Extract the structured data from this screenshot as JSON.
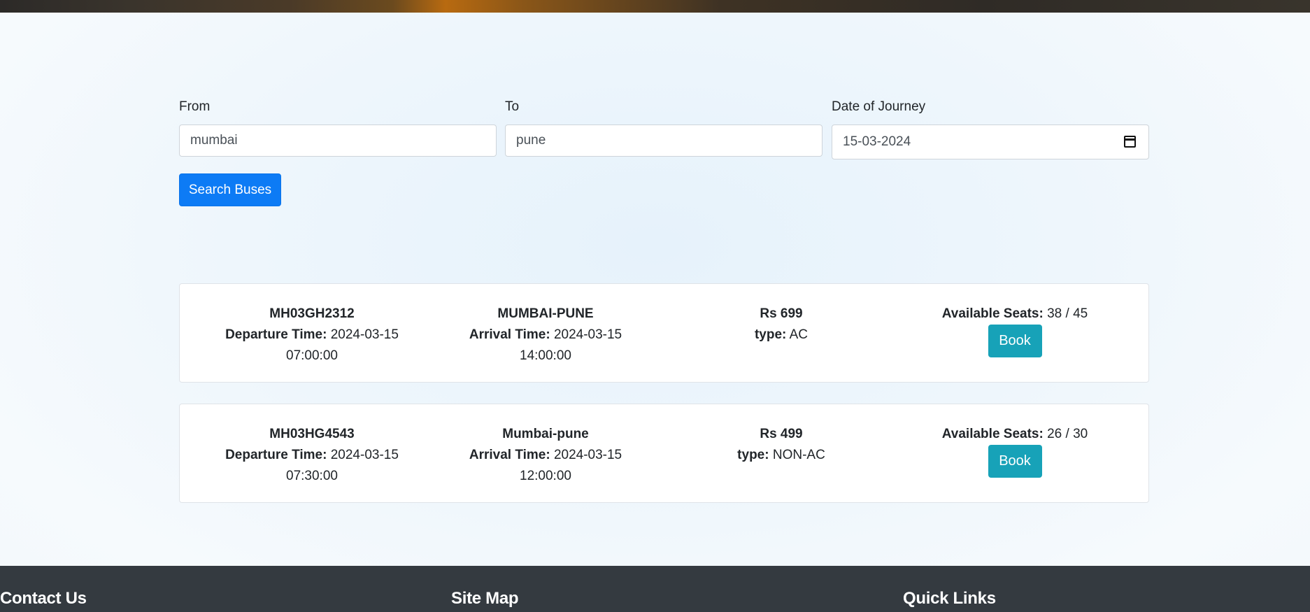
{
  "search": {
    "from_label": "From",
    "from_value": "mumbai",
    "to_label": "To",
    "to_value": "pune",
    "date_label": "Date of Journey",
    "date_value": "15-03-2024",
    "button_label": "Search Buses"
  },
  "labels": {
    "departure": "Departure Time:",
    "arrival": "Arrival Time:",
    "type": "type:",
    "seats": "Available Seats:",
    "book": "Book"
  },
  "buses": [
    {
      "bus_number": "MH03GH2312",
      "departure_date": "2024-03-15",
      "departure_time": "07:00:00",
      "route": "MUMBAI-PUNE",
      "arrival_date": "2024-03-15",
      "arrival_time": "14:00:00",
      "price": "Rs 699",
      "type": "AC",
      "seats": "38 / 45"
    },
    {
      "bus_number": "MH03HG4543",
      "departure_date": "2024-03-15",
      "departure_time": "07:30:00",
      "route": "Mumbai-pune",
      "arrival_date": "2024-03-15",
      "arrival_time": "12:00:00",
      "price": "Rs 499",
      "type": "NON-AC",
      "seats": "26 / 30"
    }
  ],
  "footer": {
    "contact": "Contact Us",
    "sitemap": "Site Map",
    "quicklinks": "Quick Links"
  }
}
